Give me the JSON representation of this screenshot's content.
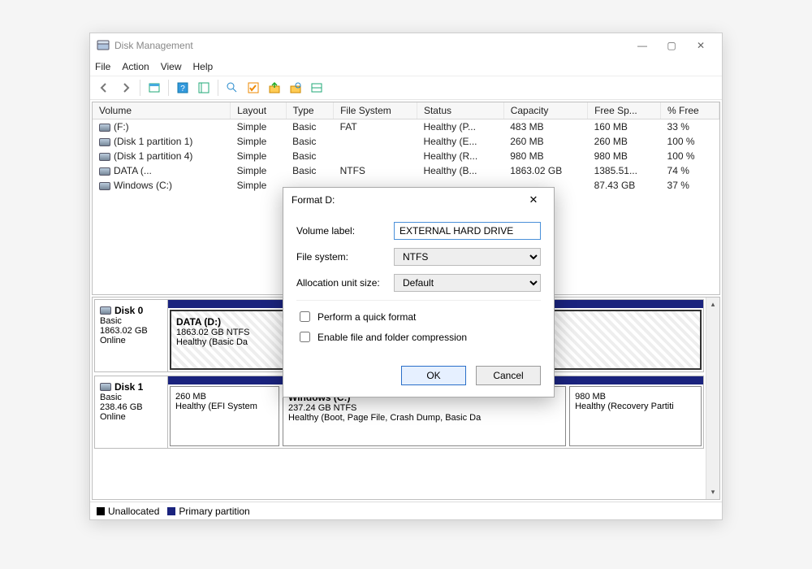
{
  "window": {
    "title": "Disk Management",
    "menu": [
      "File",
      "Action",
      "View",
      "Help"
    ]
  },
  "columns": [
    "Volume",
    "Layout",
    "Type",
    "File System",
    "Status",
    "Capacity",
    "Free Sp...",
    "% Free"
  ],
  "volumes": [
    {
      "name": "(F:)",
      "layout": "Simple",
      "type": "Basic",
      "fs": "FAT",
      "status": "Healthy (P...",
      "capacity": "483 MB",
      "free": "160 MB",
      "pct": "33 %"
    },
    {
      "name": "(Disk 1 partition 1)",
      "layout": "Simple",
      "type": "Basic",
      "fs": "",
      "status": "Healthy (E...",
      "capacity": "260 MB",
      "free": "260 MB",
      "pct": "100 %"
    },
    {
      "name": "(Disk 1 partition 4)",
      "layout": "Simple",
      "type": "Basic",
      "fs": "",
      "status": "Healthy (R...",
      "capacity": "980 MB",
      "free": "980 MB",
      "pct": "100 %"
    },
    {
      "name": "DATA (...",
      "layout": "Simple",
      "type": "Basic",
      "fs": "NTFS",
      "status": "Healthy (B...",
      "capacity": "1863.02 GB",
      "free": "1385.51...",
      "pct": "74 %"
    },
    {
      "name": "Windows (C:)",
      "layout": "Simple",
      "type": "",
      "fs": "",
      "status": "",
      "capacity": "",
      "free": "87.43 GB",
      "pct": "37 %"
    }
  ],
  "disks": [
    {
      "title": "Disk 0",
      "type": "Basic",
      "size": "1863.02 GB",
      "status": "Online",
      "parts": [
        {
          "name": "DATA  (D:)",
          "line2": "1863.02 GB NTFS",
          "line3": "Healthy (Basic Da",
          "selected": true,
          "flex": 1
        }
      ]
    },
    {
      "title": "Disk 1",
      "type": "Basic",
      "size": "238.46 GB",
      "status": "Online",
      "parts": [
        {
          "name": "",
          "line2": "260 MB",
          "line3": "Healthy (EFI System",
          "flex": 1.3
        },
        {
          "name": "Windows  (C:)",
          "line2": "237.24 GB NTFS",
          "line3": "Healthy (Boot, Page File, Crash Dump, Basic Da",
          "flex": 3.6
        },
        {
          "name": "",
          "line2": "980 MB",
          "line3": "Healthy (Recovery Partiti",
          "flex": 1.6
        }
      ]
    }
  ],
  "legend": {
    "unallocated": "Unallocated",
    "primary": "Primary partition"
  },
  "dialog": {
    "title": "Format D:",
    "volume_label_lbl": "Volume label:",
    "volume_label_val": "EXTERNAL HARD DRIVE",
    "file_system_lbl": "File system:",
    "file_system_val": "NTFS",
    "alloc_lbl": "Allocation unit size:",
    "alloc_val": "Default",
    "quick_format": "Perform a quick format",
    "compression": "Enable file and folder compression",
    "ok": "OK",
    "cancel": "Cancel"
  }
}
